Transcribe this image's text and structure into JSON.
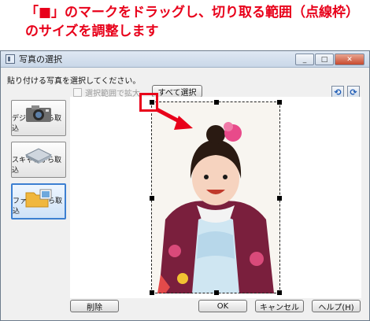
{
  "instruction": {
    "line1": "「■」のマークをドラッグし、切り取る範囲（点線枠）",
    "line2": "のサイズを調整します"
  },
  "window": {
    "title": "写真の選択",
    "buttons": {
      "minimize": "_",
      "maximize": "□",
      "close": "✕"
    }
  },
  "prompt": "貼り付ける写真を選択してください。",
  "options": {
    "zoom_checkbox_label": "選択範囲で拡大",
    "select_all_label": "すべて選択"
  },
  "sidebar": [
    {
      "label": "デジカメから取込",
      "icon": "camera-icon",
      "active": false
    },
    {
      "label": "スキャナから取込",
      "icon": "scanner-icon",
      "active": false
    },
    {
      "label": "ファイルから取込",
      "icon": "folder-icon",
      "active": true
    }
  ],
  "bottom": {
    "delete_label": "削除",
    "ok_label": "OK",
    "cancel_label": "キャンセル",
    "help_label": "ヘルプ(H)"
  },
  "colors": {
    "instruction": "#e8001a",
    "accent": "#3c7fd1"
  }
}
